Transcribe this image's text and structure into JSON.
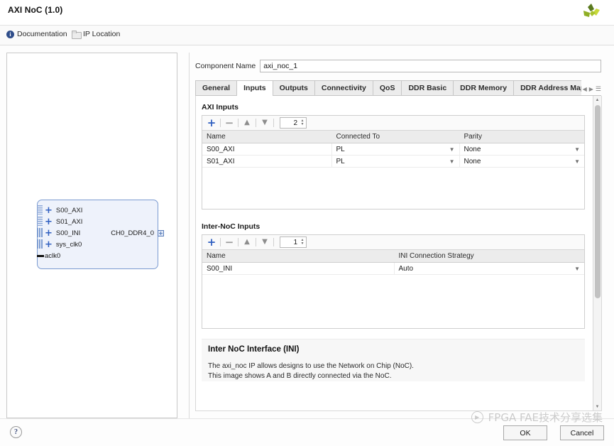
{
  "window": {
    "title": "AXI NoC (1.0)",
    "logo_icon": "xilinx-pinwheel-logo"
  },
  "toolbar": {
    "documentation_label": "Documentation",
    "documentation_icon": "info-icon",
    "ip_location_label": "IP Location",
    "ip_location_icon": "folder-icon"
  },
  "preview": {
    "block_ports_left": [
      {
        "name": "S00_AXI",
        "pin": "plus",
        "stub": "dotted"
      },
      {
        "name": "S01_AXI",
        "pin": "plus",
        "stub": "dotted"
      },
      {
        "name": "S00_INI",
        "pin": "plus",
        "stub": "solid"
      },
      {
        "name": "sys_clk0",
        "pin": "plus",
        "stub": "solid"
      },
      {
        "name": "aclk0",
        "pin": "dash",
        "stub": "none"
      }
    ],
    "block_port_right": "CH0_DDR4_0"
  },
  "component": {
    "name_label": "Component Name",
    "name_value": "axi_noc_1"
  },
  "tabs": [
    {
      "label": "General",
      "active": false
    },
    {
      "label": "Inputs",
      "active": true
    },
    {
      "label": "Outputs",
      "active": false
    },
    {
      "label": "Connectivity",
      "active": false
    },
    {
      "label": "QoS",
      "active": false
    },
    {
      "label": "DDR Basic",
      "active": false
    },
    {
      "label": "DDR Memory",
      "active": false
    },
    {
      "label": "DDR Address Mappir",
      "active": false
    }
  ],
  "tab_nav": {
    "prev_icon": "chevron-left-icon",
    "next_icon": "chevron-right-icon",
    "list_icon": "tab-list-icon"
  },
  "axi_inputs": {
    "section_title": "AXI Inputs",
    "toolbar": {
      "add_icon": "plus-icon",
      "remove_icon": "minus-icon",
      "move_up_icon": "arrow-up-icon",
      "move_down_icon": "arrow-down-icon",
      "count_value": "2"
    },
    "columns": [
      "Name",
      "Connected To",
      "Parity"
    ],
    "rows": [
      {
        "name": "S00_AXI",
        "connected_to": "PL",
        "parity": "None"
      },
      {
        "name": "S01_AXI",
        "connected_to": "PL",
        "parity": "None"
      }
    ]
  },
  "inter_noc_inputs": {
    "section_title": "Inter-NoC Inputs",
    "toolbar": {
      "add_icon": "plus-icon",
      "remove_icon": "minus-icon",
      "move_up_icon": "arrow-up-icon",
      "move_down_icon": "arrow-down-icon",
      "count_value": "1"
    },
    "columns": [
      "Name",
      "INI Connection Strategy"
    ],
    "rows": [
      {
        "name": "S00_INI",
        "strategy": "Auto"
      }
    ]
  },
  "info": {
    "heading": "Inter NoC Interface (INI)",
    "line1": "The axi_noc IP allows designs to use the Network on Chip (NoC).",
    "line2": "This image shows A and B directly connected via the NoC."
  },
  "footer": {
    "help_label": "?",
    "ok_label": "OK",
    "cancel_label": "Cancel"
  },
  "watermark": {
    "text": "FPGA FAE技术分享选集"
  },
  "colors": {
    "accent_blue": "#2f5fc0",
    "block_fill": "#eef2fb",
    "block_border": "#7b9bd1",
    "tab_inactive": "#ececec"
  }
}
